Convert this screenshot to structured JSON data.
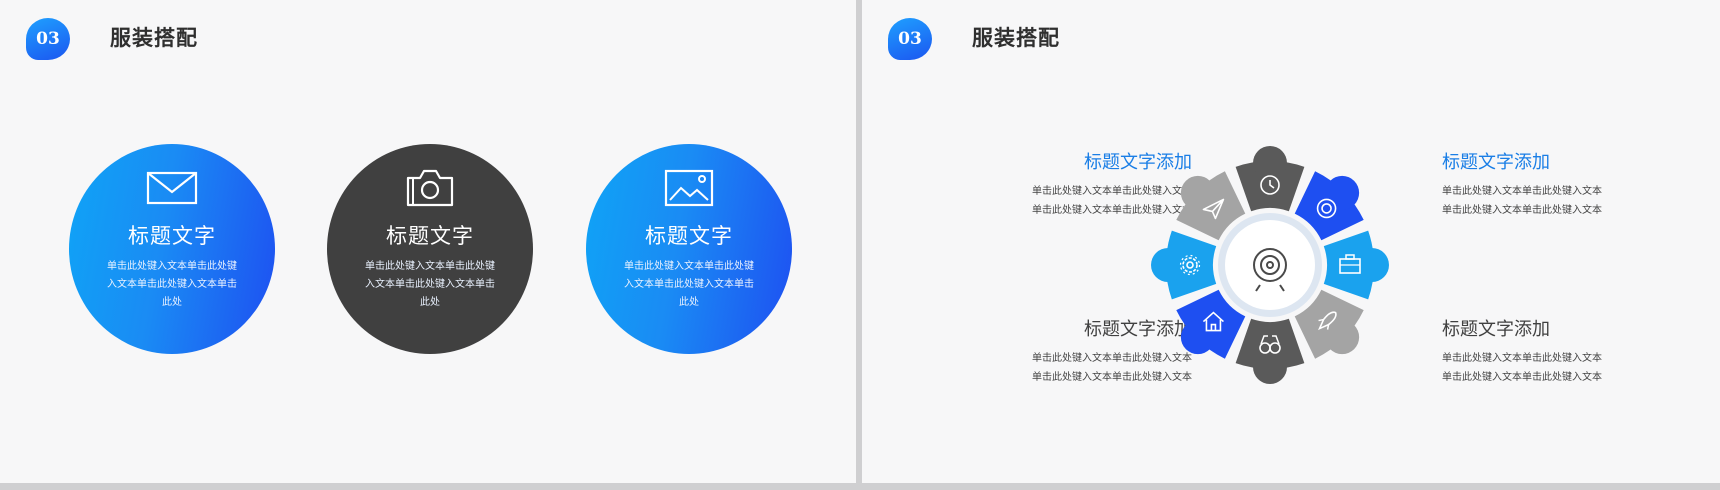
{
  "left": {
    "badge": "03",
    "title": "服装搭配",
    "circles": [
      {
        "icon": "envelope-icon",
        "title": "标题文字",
        "text": "单击此处键入文本单击此处键入文本单击此处键入文本单击此处"
      },
      {
        "icon": "camera-icon",
        "title": "标题文字",
        "text": "单击此处键入文本单击此处键入文本单击此处键入文本单击此处"
      },
      {
        "icon": "image-icon",
        "title": "标题文字",
        "text": "单击此处键入文本单击此处键入文本单击此处键入文本单击此处"
      }
    ]
  },
  "right": {
    "badge": "03",
    "title": "服装搭配",
    "blocks": [
      {
        "title": "标题文字添加",
        "lines": [
          "单击此处键入文本单击此处键入文本",
          "单击此处键入文本单击此处键入文本"
        ]
      },
      {
        "title": "标题文字添加",
        "lines": [
          "单击此处键入文本单击此处键入文本",
          "单击此处键入文本单击此处键入文本"
        ]
      },
      {
        "title": "标题文字添加",
        "lines": [
          "单击此处键入文本单击此处键入文本",
          "单击此处键入文本单击此处键入文本"
        ]
      },
      {
        "title": "标题文字添加",
        "lines": [
          "单击此处键入文本单击此处键入文本",
          "单击此处键入文本单击此处键入文本"
        ]
      }
    ],
    "wheel_center_icon": "target-icon",
    "wheel_segments": [
      {
        "icon": "clock-icon",
        "color": "#5a5a5a"
      },
      {
        "icon": "lifebuoy-icon",
        "color": "#1e4ff1"
      },
      {
        "icon": "briefcase-icon",
        "color": "#1aa2ee"
      },
      {
        "icon": "rocket-icon",
        "color": "#a4a4a4"
      },
      {
        "icon": "binoculars-icon",
        "color": "#5a5a5a"
      },
      {
        "icon": "home-icon",
        "color": "#1e4ff1"
      },
      {
        "icon": "gear-icon",
        "color": "#1aa2ee"
      },
      {
        "icon": "paper-plane-icon",
        "color": "#a4a4a4"
      }
    ]
  }
}
